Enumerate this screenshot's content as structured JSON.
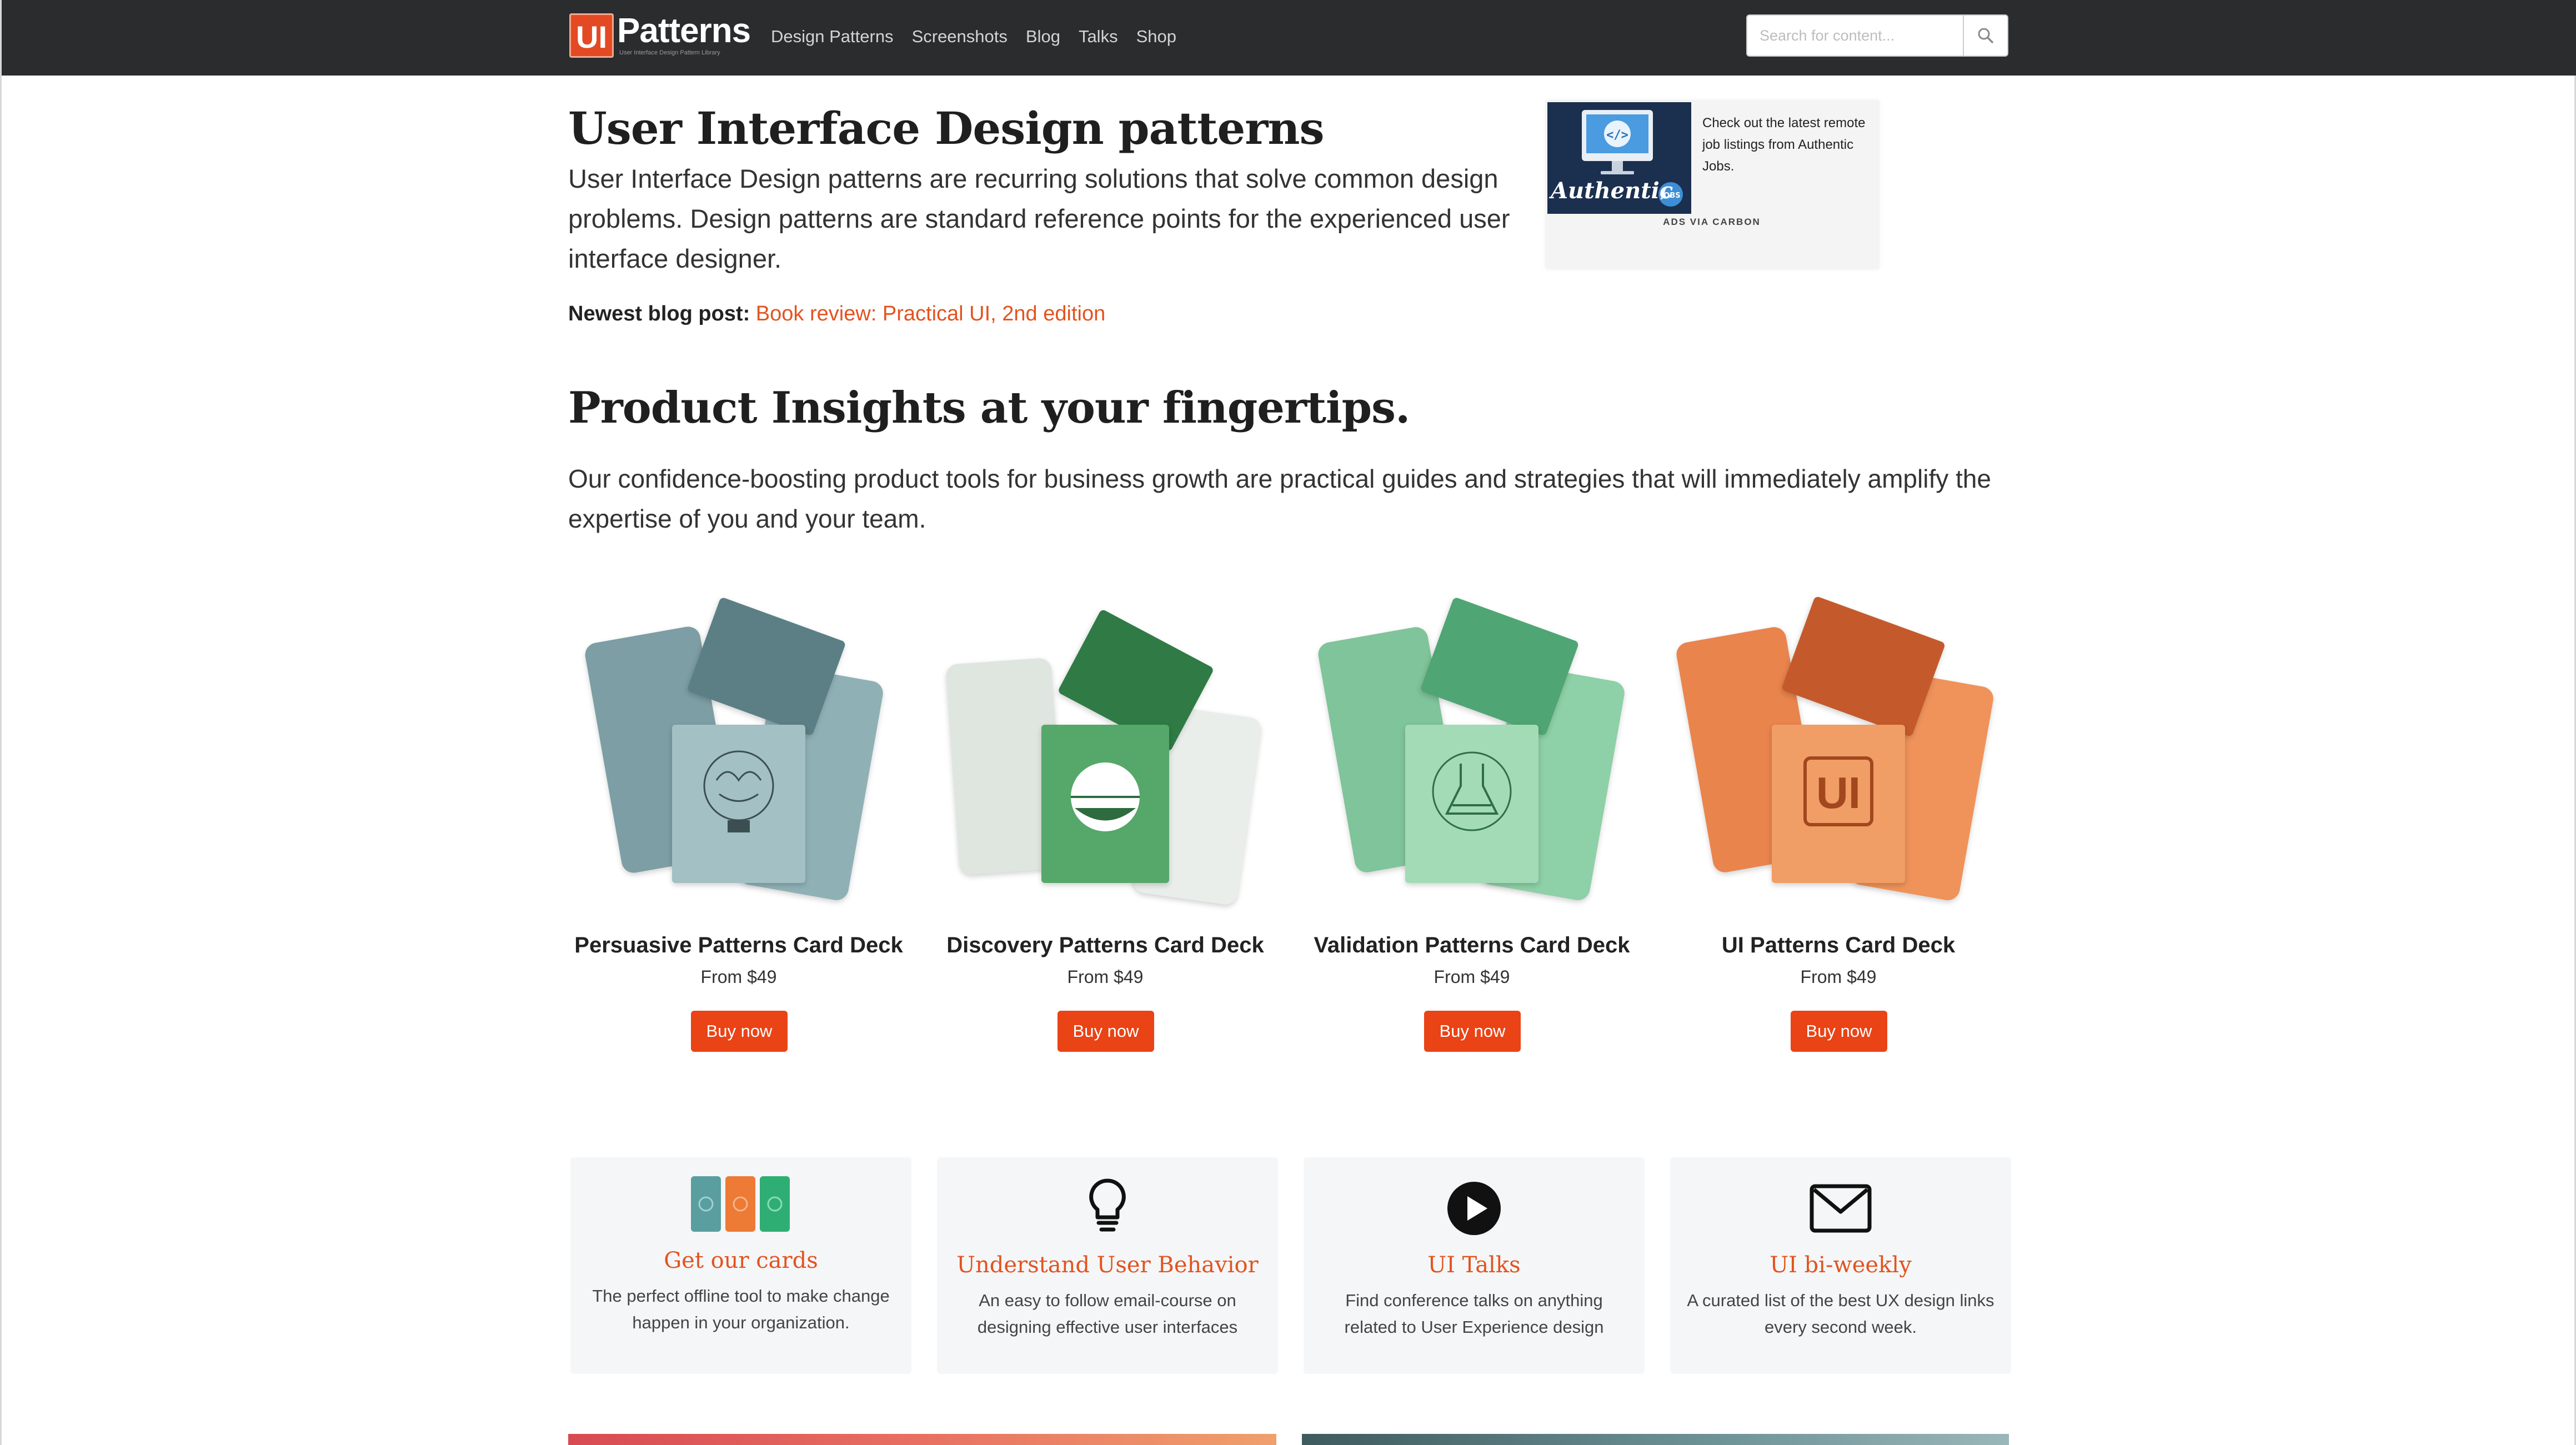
{
  "nav": {
    "logo_mark": "UI",
    "logo_text": "Patterns",
    "logo_tagline": "User Interface Design Pattern Library",
    "links": [
      "Design Patterns",
      "Screenshots",
      "Blog",
      "Talks",
      "Shop"
    ],
    "search_placeholder": "Search for content..."
  },
  "hero": {
    "title": "User Interface Design patterns",
    "lead": "User Interface Design patterns are recurring solutions that solve common design problems. Design patterns are standard reference points for the experienced user interface designer.",
    "blog_label": "Newest blog post:",
    "blog_link": "Book review: Practical UI, 2nd edition"
  },
  "ad": {
    "brand": "Authentic",
    "badge": "JOBS",
    "text": "Check out the latest remote job listings from Authentic Jobs.",
    "via": "ADS VIA CARBON"
  },
  "insights": {
    "title": "Product Insights at your fingertips.",
    "lead": "Our confidence-boosting product tools for business growth are practical guides and strategies that will immediately amplify the expertise of you and your team."
  },
  "products": [
    {
      "name": "Persuasive Patterns Card Deck",
      "price": "From $49",
      "cta": "Buy now",
      "palette": {
        "back": "#7c9ea4",
        "mid": "#8fb1b6",
        "front": "#a3c0c4",
        "box": "#5b7f85",
        "ink": "#4d6b70"
      }
    },
    {
      "name": "Discovery Patterns Card Deck",
      "price": "From $49",
      "cta": "Buy now",
      "palette": {
        "back": "#dfe6e0",
        "mid": "#e9eeea",
        "front": "#55a86a",
        "box": "#2f7a45",
        "ink": "#2e6b3e"
      }
    },
    {
      "name": "Validation Patterns Card Deck",
      "price": "From $49",
      "cta": "Buy now",
      "palette": {
        "back": "#7fc49a",
        "mid": "#8ed0a7",
        "front": "#a2dbb6",
        "box": "#4fa574",
        "ink": "#2f6e49"
      }
    },
    {
      "name": "UI Patterns Card Deck",
      "price": "From $49",
      "cta": "Buy now",
      "palette": {
        "back": "#e9844d",
        "mid": "#ef935a",
        "front": "#f19d66",
        "box": "#c45a2b",
        "ink": "#a2471e"
      }
    }
  ],
  "features": [
    {
      "icon": "cards-icon",
      "title": "Get our cards",
      "desc": "The perfect offline tool to make change happen in your organization."
    },
    {
      "icon": "lightbulb-icon",
      "title": "Understand User Behavior",
      "desc": "An easy to follow email-course on designing effective user interfaces"
    },
    {
      "icon": "play-icon",
      "title": "UI Talks",
      "desc": "Find conference talks on anything related to User Experience design"
    },
    {
      "icon": "envelope-icon",
      "title": "UI bi-weekly",
      "desc": "A curated list of the best UX design links every second week."
    }
  ],
  "colors": {
    "accent": "#e3531f",
    "button": "#e94316",
    "nav_bg": "#2b2c2e"
  }
}
